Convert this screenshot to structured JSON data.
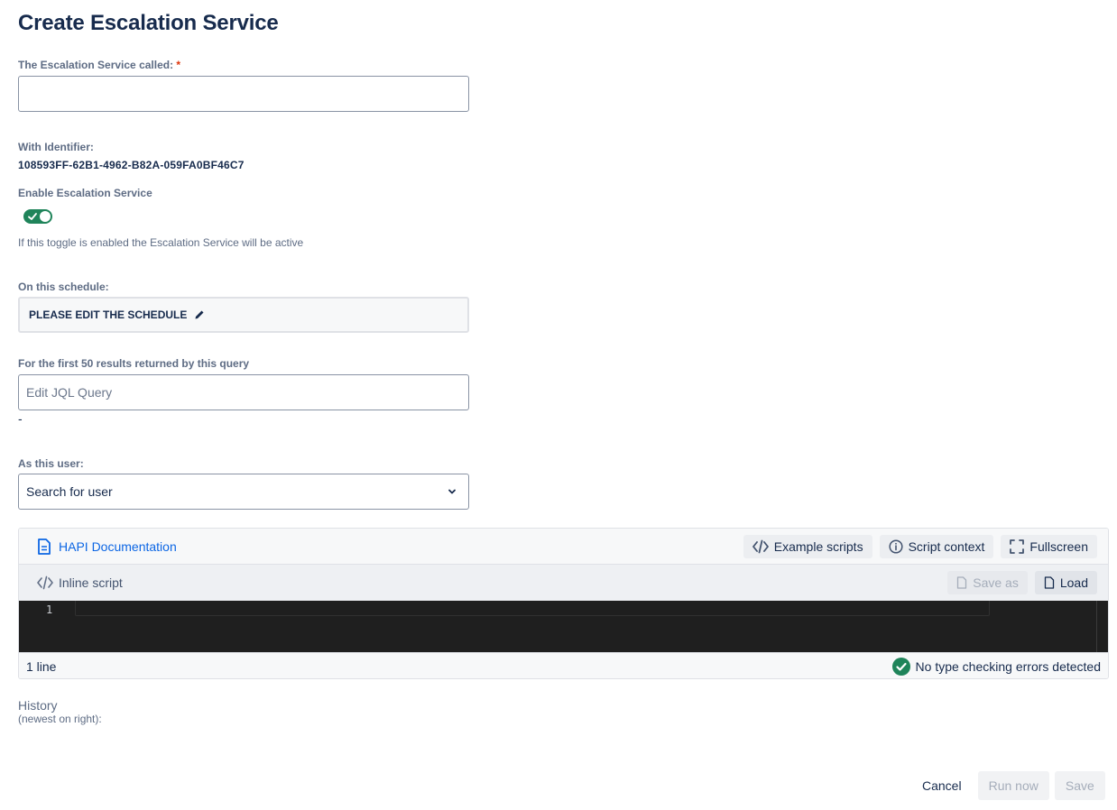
{
  "page": {
    "title": "Create Escalation Service"
  },
  "name_field": {
    "label": "The Escalation Service called:",
    "required_mark": "*",
    "value": ""
  },
  "identifier": {
    "label": "With Identifier:",
    "value": "108593FF-62B1-4962-B82A-059FA0BF46C7"
  },
  "enable": {
    "label": "Enable Escalation Service",
    "enabled": true,
    "helper": "If this toggle is enabled the Escalation Service will be active"
  },
  "schedule": {
    "label": "On this schedule:",
    "value": "PLEASE EDIT THE SCHEDULE"
  },
  "query": {
    "label": "For the first 50 results returned by this query",
    "placeholder": "Edit JQL Query",
    "below": "-"
  },
  "user": {
    "label": "As this user:",
    "placeholder": "Search for user"
  },
  "editor": {
    "doc_link": "HAPI Documentation",
    "example_scripts": "Example scripts",
    "script_context": "Script context",
    "fullscreen": "Fullscreen",
    "mode": "Inline script",
    "save_as": "Save as",
    "load": "Load",
    "line_number": "1",
    "line_count": "1 line",
    "status": "No type checking errors detected",
    "status_color": "#1f845a"
  },
  "history": {
    "title": "History",
    "subtitle": "(newest on right):"
  },
  "footer": {
    "cancel": "Cancel",
    "run_now": "Run now",
    "save": "Save"
  }
}
